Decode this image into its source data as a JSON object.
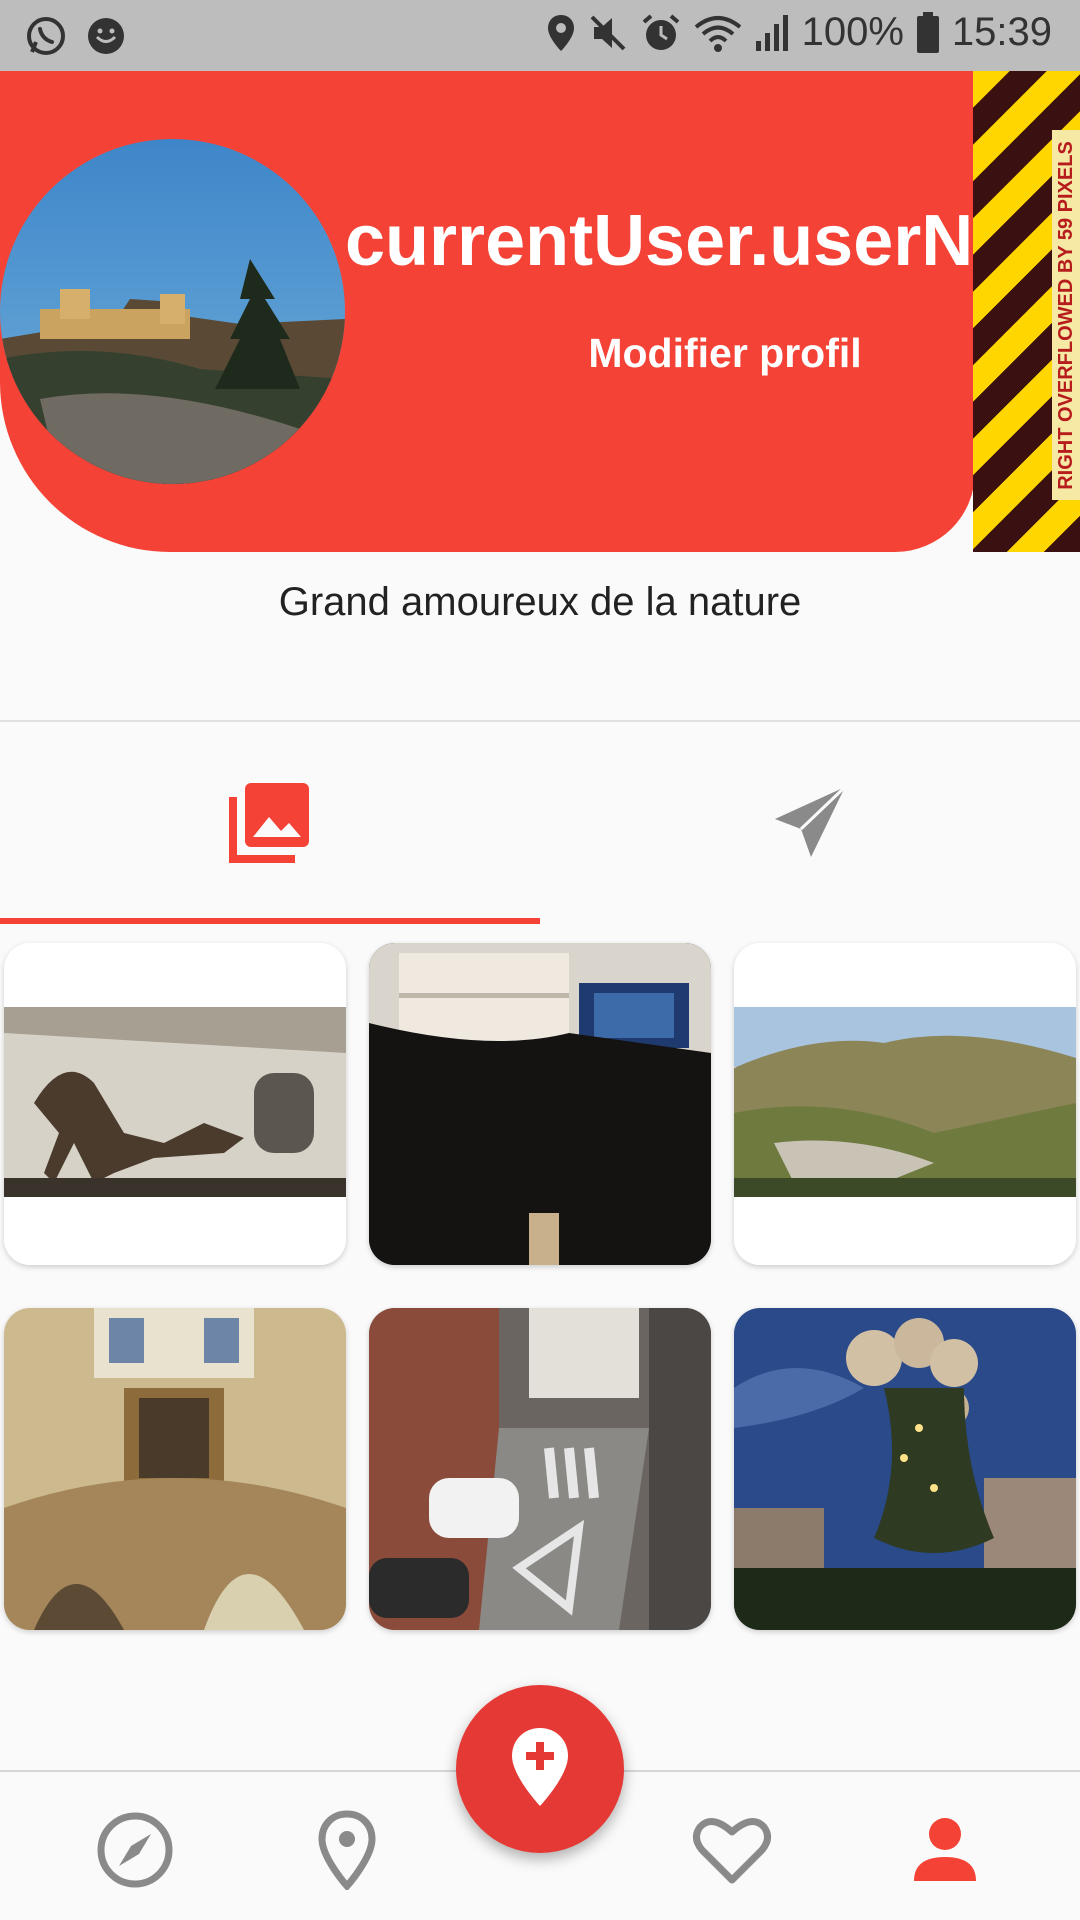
{
  "status_bar": {
    "battery": "100%",
    "time": "15:39",
    "left_icons": [
      "whatsapp-icon",
      "smiley-icon"
    ],
    "right_icons": [
      "location-icon",
      "mute-icon",
      "alarm-icon",
      "wifi-icon",
      "signal-icon",
      "battery-icon"
    ]
  },
  "header": {
    "username": "currentUser.userName",
    "edit_label": "Modifier profil",
    "overflow_warning": "RIGHT OVERFLOWED BY 59 PIXELS"
  },
  "bio": "Grand amoureux de la nature",
  "tabs": [
    {
      "icon": "photo-library-icon",
      "active": true
    },
    {
      "icon": "send-icon",
      "active": false
    }
  ],
  "photos": [
    {
      "subject": "dinosaur skeleton museum"
    },
    {
      "subject": "office desk monitor"
    },
    {
      "subject": "hills landscape"
    },
    {
      "subject": "cathedral interior"
    },
    {
      "subject": "street from balcony"
    },
    {
      "subject": "illuminated tree sculpture at night"
    }
  ],
  "bottom_nav": {
    "items": [
      "explore-icon",
      "location-pin-icon",
      "add-location-icon",
      "favorite-icon",
      "person-icon"
    ],
    "active": "person-icon"
  },
  "colors": {
    "accent": "#f44336",
    "fab": "#e53935",
    "inactive_icon": "#8a8a8a"
  }
}
